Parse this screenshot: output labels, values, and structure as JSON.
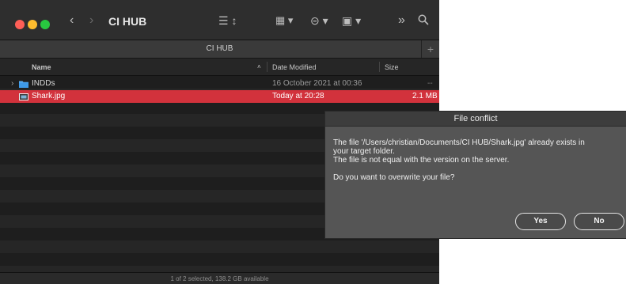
{
  "window": {
    "title": "CI HUB",
    "tab_title": "CI HUB",
    "tab_add_label": "+",
    "status": "1 of 2 selected, 138.2 GB available"
  },
  "columns": {
    "name": "Name",
    "date": "Date Modified",
    "size": "Size"
  },
  "files": [
    {
      "disclosure": "›",
      "icon": "folder-icon",
      "name": "INDDs",
      "date": "16 October 2021 at 00:36",
      "size": "--",
      "selected": false
    },
    {
      "disclosure": "",
      "icon": "image-file-icon",
      "name": "Shark.jpg",
      "date": "Today at 20:28",
      "size": "2.1 MB",
      "selected": true
    }
  ],
  "dialog": {
    "title": "File conflict",
    "lines": [
      "The file '/Users/christian/Documents/CI HUB/Shark.jpg' already exists in",
      "your target folder.",
      "The file is not equal with the version on the server."
    ],
    "question": "Do you want to overwrite your file?",
    "yes_label": "Yes",
    "no_label": "No"
  },
  "colors": {
    "selection": "#d2323c",
    "dialog_bg": "#555555",
    "toolbar_bg": "#2e2e2e"
  }
}
